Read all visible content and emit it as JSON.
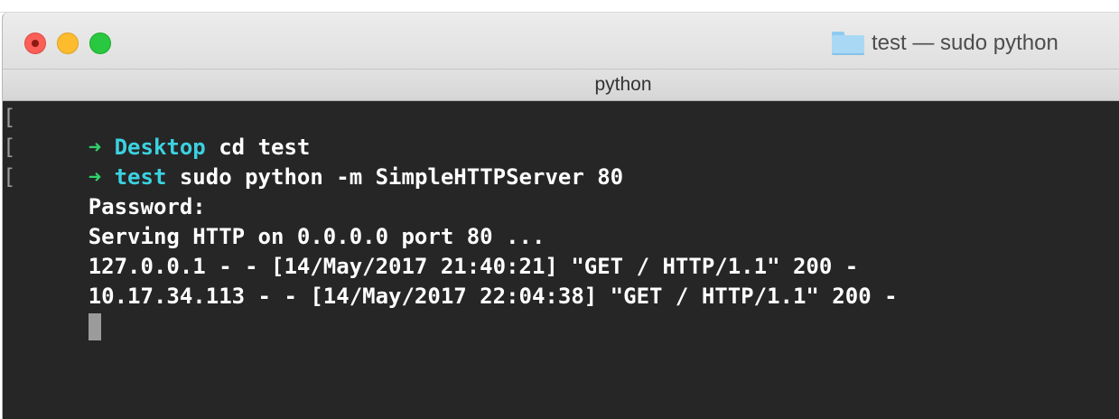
{
  "window": {
    "title": "test — sudo python",
    "tab_label": "python"
  },
  "terminal": {
    "lines": [
      {
        "mark": "[",
        "prompt_arrow": "➜",
        "directory": "Desktop",
        "command": "cd test"
      },
      {
        "mark": "[",
        "prompt_arrow": "➜",
        "directory": "test",
        "command": "sudo python -m SimpleHTTPServer 80"
      },
      {
        "mark": "[",
        "text": "Password:"
      },
      {
        "text": "Serving HTTP on 0.0.0.0 port 80 ..."
      },
      {
        "text": "127.0.0.1 - - [14/May/2017 21:40:21] \"GET / HTTP/1.1\" 200 -"
      },
      {
        "text": "10.17.34.113 - - [14/May/2017 22:04:38] \"GET / HTTP/1.1\" 200 -"
      }
    ]
  },
  "colors": {
    "background": "#262626",
    "prompt_arrow": "#2fd36b",
    "directory": "#3bd1e0",
    "text": "#ffffff",
    "cursor": "#9b9b9b"
  },
  "icons": {
    "close": "close-button",
    "minimize": "minimize-button",
    "maximize": "maximize-button",
    "folder": "folder-icon"
  }
}
